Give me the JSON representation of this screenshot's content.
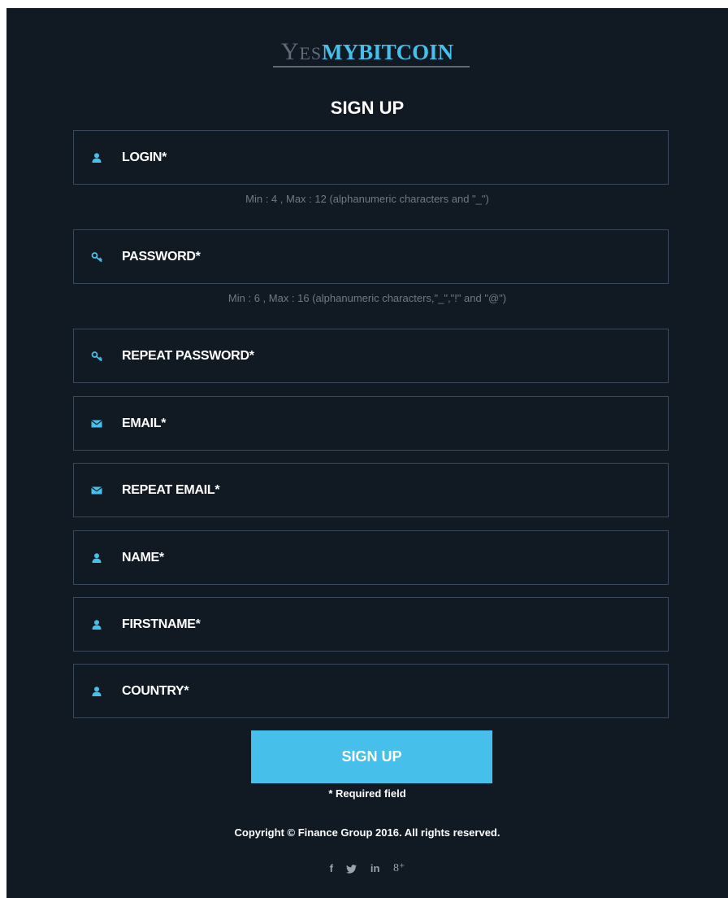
{
  "logo": {
    "yes_initial": "Y",
    "yes_rest": "ES",
    "brand": "MYBITCOIN"
  },
  "title": "SIGN UP",
  "fields": [
    {
      "label": "LOGIN*",
      "icon": "user-icon"
    },
    {
      "label": "PASSWORD*",
      "icon": "key-icon"
    },
    {
      "label": "REPEAT PASSWORD*",
      "icon": "key-icon"
    },
    {
      "label": "EMAIL*",
      "icon": "envelope-icon"
    },
    {
      "label": "REPEAT EMAIL*",
      "icon": "envelope-icon"
    },
    {
      "label": "NAME*",
      "icon": "user-icon"
    },
    {
      "label": "FIRSTNAME*",
      "icon": "user-icon"
    },
    {
      "label": "COUNTRY*",
      "icon": "user-icon"
    }
  ],
  "hints": {
    "login": "Min : 4 , Max : 12 (alphanumeric characters and \"_\")",
    "password": "Min : 6 , Max : 16 (alphanumeric characters,\"_\",\"!\" and \"@\")"
  },
  "submit_label": "SIGN UP",
  "required_note": "* Required field",
  "copyright": "Copyright © Finance Group 2016. All rights reserved.",
  "social": {
    "facebook": "f",
    "linkedin": "in",
    "googleplus": "8⁺"
  },
  "colors": {
    "background": "#111922",
    "accent": "#46bfea",
    "border": "#3a4a5c",
    "hint": "#6f7a85",
    "logo_muted": "#5e6b79"
  }
}
